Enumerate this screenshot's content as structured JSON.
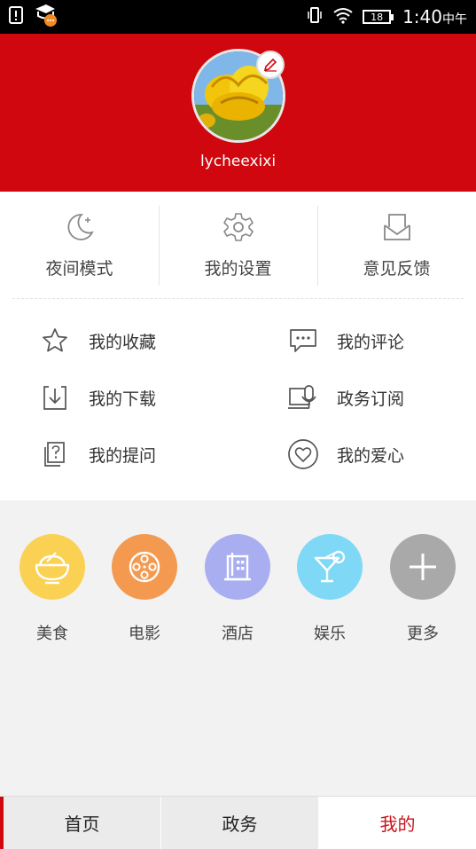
{
  "status_bar": {
    "time": "1:40",
    "time_suffix": "中午",
    "battery": "18"
  },
  "profile": {
    "username": "lycheexixi"
  },
  "quick_actions": [
    {
      "label": "夜间模式",
      "icon": "moon-icon"
    },
    {
      "label": "我的设置",
      "icon": "gear-icon"
    },
    {
      "label": "意见反馈",
      "icon": "feedback-icon"
    }
  ],
  "menu": [
    {
      "label": "我的收藏",
      "icon": "star-icon"
    },
    {
      "label": "我的评论",
      "icon": "comment-icon"
    },
    {
      "label": "我的下载",
      "icon": "download-icon"
    },
    {
      "label": "政务订阅",
      "icon": "subscribe-icon"
    },
    {
      "label": "我的提问",
      "icon": "question-icon"
    },
    {
      "label": "我的爱心",
      "icon": "heart-icon"
    }
  ],
  "categories": [
    {
      "label": "美食",
      "icon": "bowl-icon",
      "color": "#fbd154"
    },
    {
      "label": "电影",
      "icon": "film-reel-icon",
      "color": "#f39a50"
    },
    {
      "label": "酒店",
      "icon": "hotel-icon",
      "color": "#a9aef0"
    },
    {
      "label": "娱乐",
      "icon": "cocktail-icon",
      "color": "#7fd8f5"
    },
    {
      "label": "更多",
      "icon": "plus-icon",
      "color": "#a9a9a9"
    }
  ],
  "tabs": [
    {
      "label": "首页"
    },
    {
      "label": "政务"
    },
    {
      "label": "我的"
    }
  ],
  "colors": {
    "brand_red": "#d0070e",
    "active_tab_text": "#c8161d"
  }
}
